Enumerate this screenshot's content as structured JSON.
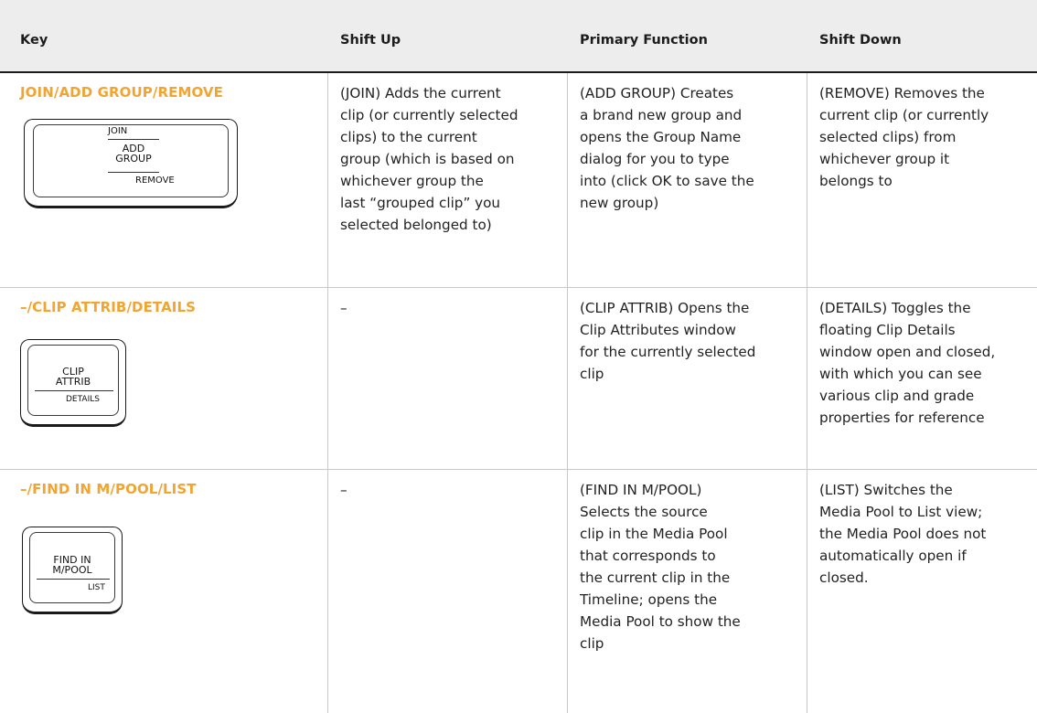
{
  "table": {
    "headers": {
      "key": "Key",
      "shift_up": "Shift Up",
      "primary": "Primary Function",
      "shift_down": "Shift Down"
    },
    "rows": [
      {
        "key_name": "JOIN/ADD GROUP/REMOVE",
        "keycap": {
          "top": "JOIN",
          "main": [
            "ADD",
            "GROUP"
          ],
          "bottom": "REMOVE"
        },
        "shift_up": [
          "(JOIN) Adds the current",
          "clip (or currently selected",
          "clips) to the current",
          "group (which is based on",
          "whichever group the",
          "last “grouped clip” you",
          "selected belonged to)"
        ],
        "primary": [
          "(ADD GROUP) Creates",
          "a brand new group and",
          "opens the Group Name",
          "dialog for you to type",
          "into (click OK to save the",
          "new group)"
        ],
        "shift_down": [
          "(REMOVE) Removes the",
          "current clip (or currently",
          "selected clips) from",
          "whichever group it",
          "belongs to"
        ]
      },
      {
        "key_name": "–/CLIP ATTRIB/DETAILS",
        "keycap": {
          "top": "",
          "main": [
            "CLIP",
            "ATTRIB"
          ],
          "bottom": "DETAILS"
        },
        "shift_up": [
          "–"
        ],
        "primary": [
          "(CLIP ATTRIB) Opens the",
          "Clip Attributes window",
          "for the currently selected",
          "clip"
        ],
        "shift_down": [
          "(DETAILS) Toggles the",
          "floating Clip Details",
          "window open and closed,",
          "with which you can see",
          "various clip and grade",
          "properties for reference"
        ]
      },
      {
        "key_name": "–/FIND IN M/POOL/LIST",
        "keycap": {
          "top": "",
          "main": [
            "FIND IN",
            "M/POOL"
          ],
          "bottom": "LIST"
        },
        "shift_up": [
          "–"
        ],
        "primary": [
          "(FIND IN M/POOL)",
          "Selects the source",
          "clip in the Media Pool",
          "that corresponds to",
          "the current clip in the",
          "Timeline; opens the",
          "Media Pool to show the",
          "clip"
        ],
        "shift_down": [
          "(LIST) Switches the",
          "Media Pool to List view;",
          "the Media Pool does not",
          "automatically open if",
          "closed."
        ]
      }
    ]
  },
  "colors": {
    "key_title": "#f2a431",
    "header_bg": "#ededed",
    "grid_line": "#c8c8c8"
  }
}
